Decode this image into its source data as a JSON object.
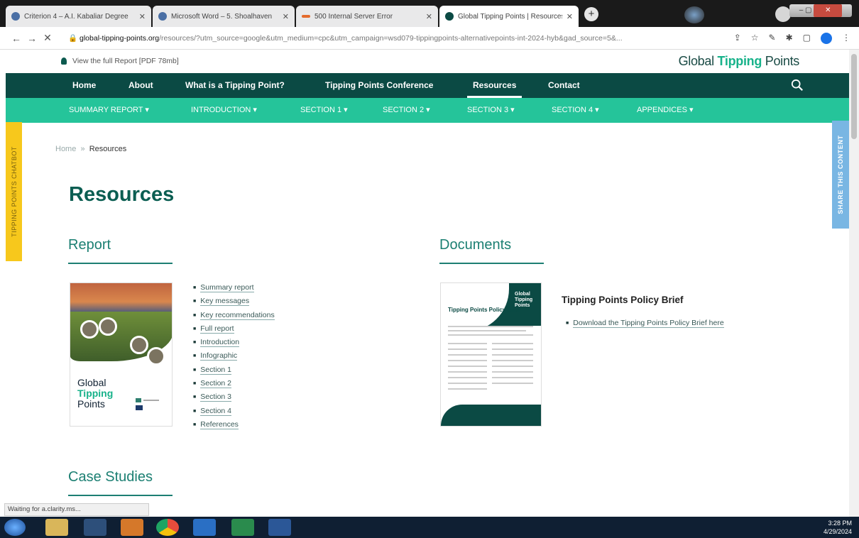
{
  "browser": {
    "tabs": [
      {
        "label": "Criterion 4 – A.I. Kabaliar Degree",
        "favicon_color": "#4a6fa5"
      },
      {
        "label": "Microsoft Word – 5. Shoalhaven",
        "favicon_color": "#4a6fa5"
      },
      {
        "label": "500 Internal Server Error",
        "favicon_color": "#e46b2d"
      },
      {
        "label": "Global Tipping Points | Resources",
        "favicon_color": "#0b4a44"
      }
    ],
    "new_tab_symbol": "+",
    "url_domain": "global-tipping-points.org",
    "url_rest": "/resources/?utm_source=google&utm_medium=cpc&utm_campaign=wsd079-tippingpoints-alternativepoints-int-2024-hyb&gad_source=5&...",
    "status_text": "Waiting for a.clarity.ms..."
  },
  "site": {
    "pdf_link": "View the full Report [PDF 78mb]",
    "brand_prefix": "Global ",
    "brand_bold": "Tipping",
    "brand_suffix": " Points",
    "main_nav": [
      "Home",
      "About",
      "What is a Tipping Point?",
      "Tipping Points Conference",
      "Resources",
      "Contact"
    ],
    "sub_nav": [
      "SUMMARY REPORT ▾",
      "INTRODUCTION ▾",
      "SECTION 1 ▾",
      "SECTION 2 ▾",
      "SECTION 3 ▾",
      "SECTION 4 ▾",
      "APPENDICES ▾"
    ],
    "left_tab": "TIPPING POINTS CHATBOT",
    "right_tab": "SHARE THIS CONTENT"
  },
  "content": {
    "breadcrumb_home": "Home",
    "breadcrumb_sep": "»",
    "breadcrumb_current": "Resources",
    "title": "Resources",
    "report_heading": "Report",
    "report_cover": {
      "line1": "Global",
      "line2": "Tipping",
      "line3": "Points"
    },
    "report_links": [
      "Summary report",
      "Key messages",
      "Key recommendations",
      "Full report",
      "Introduction",
      "Infographic",
      "Section 1",
      "Section 2",
      "Section 3",
      "Section 4",
      "References"
    ],
    "documents_heading": "Documents",
    "brief_cover": {
      "brand": "Global Tipping Points",
      "title": "Tipping Points Policy Brief"
    },
    "brief_title": "Tipping Points Policy Brief",
    "brief_link": "Download the Tipping Points Policy Brief here",
    "case_heading": "Case Studies"
  },
  "taskbar": {
    "time": "3:28 PM",
    "date": "4/29/2024"
  }
}
